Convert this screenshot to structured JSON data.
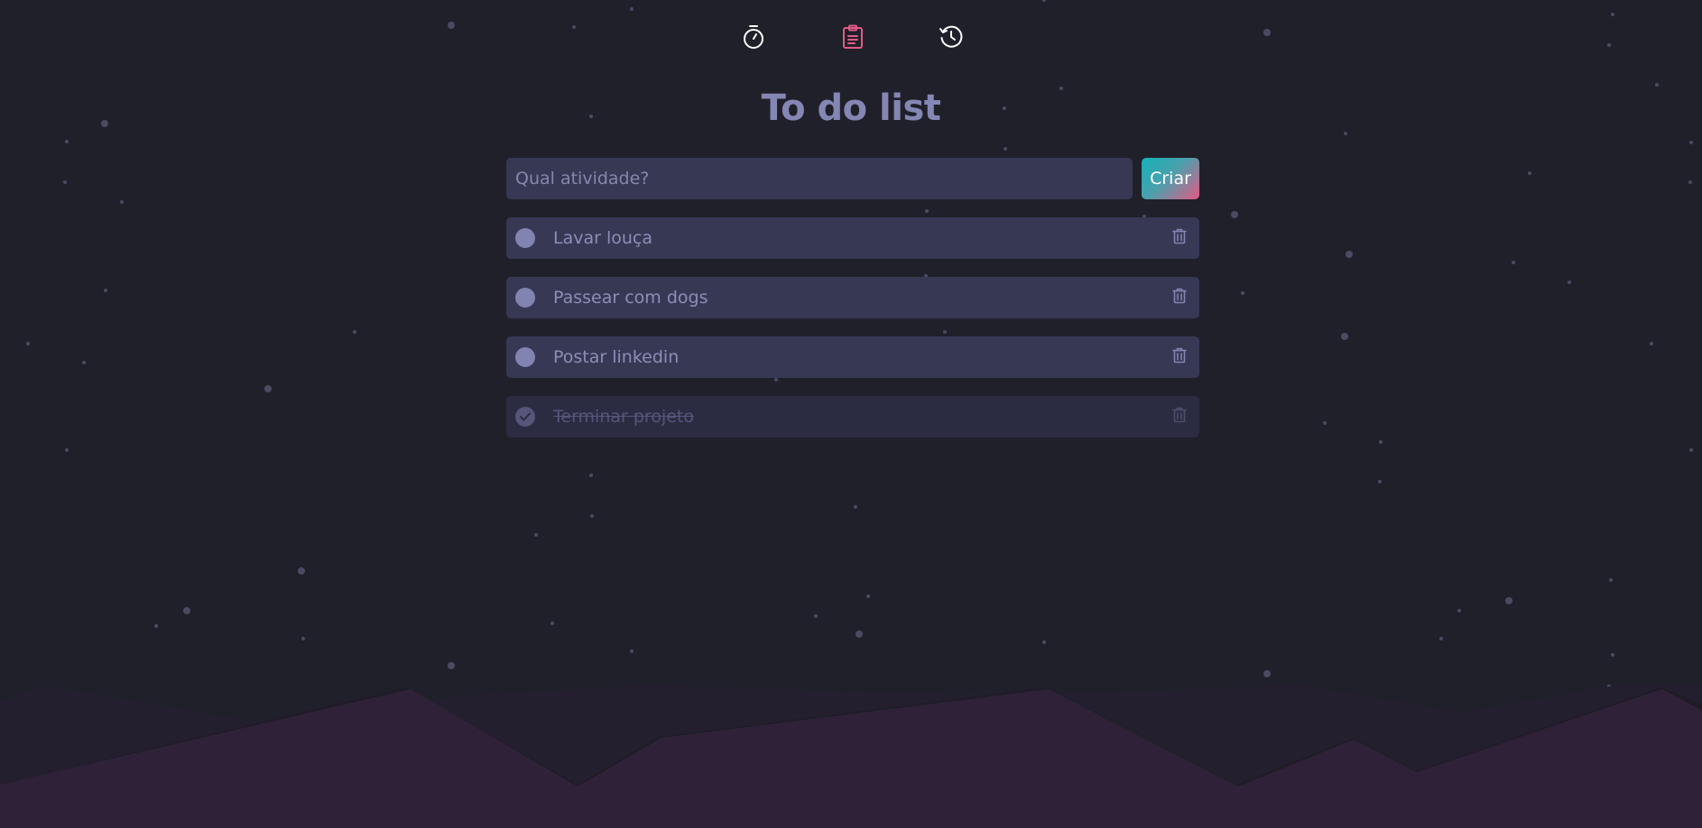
{
  "nav": {
    "items": [
      {
        "icon": "stopwatch-icon",
        "active": false
      },
      {
        "icon": "clipboard-list-icon",
        "active": true
      },
      {
        "icon": "history-icon",
        "active": false
      }
    ]
  },
  "page": {
    "title": "To do list"
  },
  "create": {
    "placeholder": "Qual atividade?",
    "value": "",
    "button_label": "Criar"
  },
  "tasks": [
    {
      "label": "Lavar louça",
      "done": false
    },
    {
      "label": "Passear com dogs",
      "done": false
    },
    {
      "label": "Postar linkedin",
      "done": false
    },
    {
      "label": "Terminar projeto",
      "done": true
    }
  ],
  "colors": {
    "background": "#20202a",
    "accent": "#e25a86",
    "title": "#8486b3",
    "card": "#373854",
    "card_done": "#2b2c41",
    "mountain_back": "#241f2e",
    "mountain_front": "#2f2238"
  }
}
